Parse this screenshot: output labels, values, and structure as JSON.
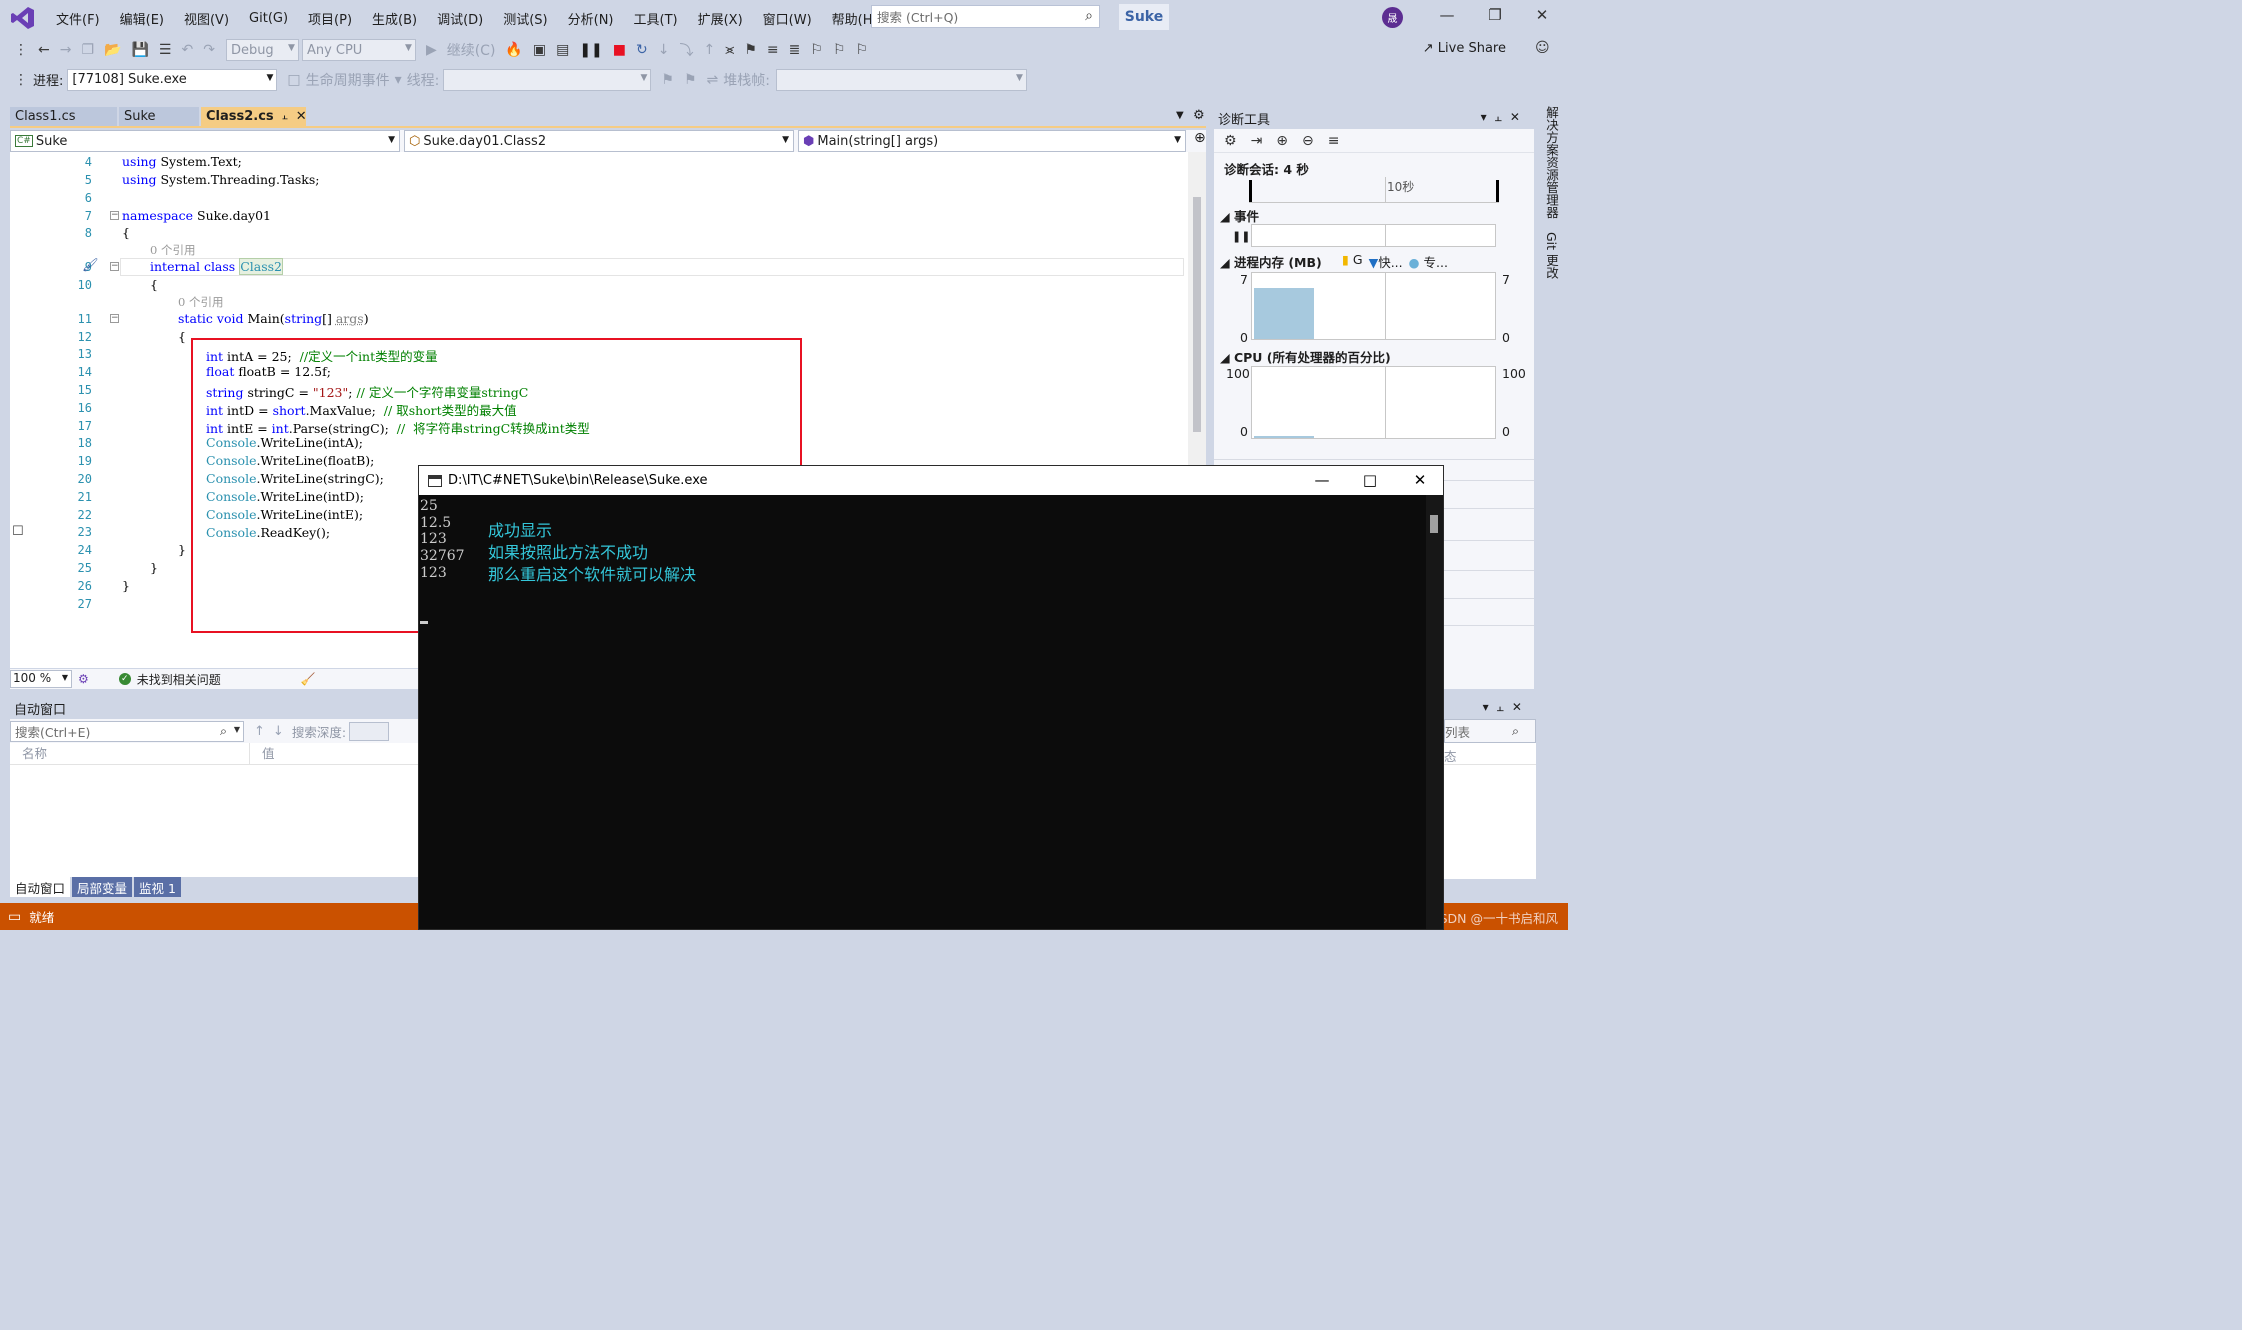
{
  "menu": {
    "items": [
      "文件(F)",
      "编辑(E)",
      "视图(V)",
      "Git(G)",
      "项目(P)",
      "生成(B)",
      "调试(D)",
      "测试(S)",
      "分析(N)",
      "工具(T)",
      "扩展(X)",
      "窗口(W)",
      "帮助(H)"
    ],
    "search_placeholder": "搜索 (Ctrl+Q)",
    "solution_name": "Suke",
    "avatar_initial": "晟"
  },
  "toolbar": {
    "config": "Debug",
    "platform": "Any CPU",
    "continue_label": "继续(C)",
    "live_share": "Live Share",
    "process_label": "进程:",
    "process_value": "[77108] Suke.exe",
    "lifecycle_label": "生命周期事件",
    "thread_label": "线程:",
    "stack_label": "堆栈帧:"
  },
  "tabs": [
    {
      "label": "Class1.cs"
    },
    {
      "label": "Suke"
    },
    {
      "label": "Class2.cs"
    }
  ],
  "navbar": {
    "project": "Suke",
    "type": "Suke.day01.Class2",
    "member": "Main(string[] args)"
  },
  "editor": {
    "line_numbers": [
      "4",
      "5",
      "6",
      "7",
      "8",
      "9",
      "10",
      "11",
      "12",
      "13",
      "14",
      "15",
      "16",
      "17",
      "18",
      "19",
      "20",
      "21",
      "22",
      "23",
      "24",
      "25",
      "26",
      "27"
    ],
    "ref_count": "0 个引用",
    "lines": {
      "l4a": "using",
      "l4b": " System.Text;",
      "l5a": "using",
      "l5b": " System.Threading.Tasks;",
      "l7a": "namespace",
      "l7b": " Suke.day01",
      "l8": "{",
      "l9a": "internal",
      "l9b": " ",
      "l9c": "class",
      "l9d": " ",
      "l9e": "Class2",
      "l10": "{",
      "l11a": "static",
      "l11b": " ",
      "l11c": "void",
      "l11d": " Main(",
      "l11e": "string",
      "l11f": "[] ",
      "l11g": "args",
      "l11h": ")",
      "l12": "{",
      "l13a": "int",
      "l13b": " intA = 25;  ",
      "l13c": "//定义一个int类型的变量",
      "l14a": "float",
      "l14b": " floatB = 12.5f;",
      "l15a": "string",
      "l15b": " stringC = ",
      "l15c": "\"123\"",
      "l15d": "; ",
      "l15e": "// 定义一个字符串变量stringC",
      "l16a": "int",
      "l16b": " intD = ",
      "l16c": "short",
      "l16d": ".MaxValue;  ",
      "l16e": "// 取short类型的最大值",
      "l17a": "int",
      "l17b": " intE = ",
      "l17c": "int",
      "l17d": ".Parse(stringC);  ",
      "l17e": "//  将字符串stringC转换成int类型",
      "l18a": "Console",
      "l18b": ".WriteLine(intA);",
      "l19a": "Console",
      "l19b": ".WriteLine(floatB);",
      "l20a": "Console",
      "l20b": ".WriteLine(stringC);",
      "l21a": "Console",
      "l21b": ".WriteLine(intD);",
      "l22a": "Console",
      "l22b": ".WriteLine(intE);",
      "l23a": "Console",
      "l23b": ".ReadKey();",
      "l24": "}",
      "l25": "}",
      "l26": "}"
    },
    "zoom": "100 %",
    "issues": "未找到相关问题"
  },
  "diagnostics": {
    "title": "诊断工具",
    "session": "诊断会话: 4 秒",
    "timeline_tick": "10秒",
    "events": "事件",
    "memory": "进程内存 (MB)",
    "legend": [
      "G",
      "快...",
      "专..."
    ],
    "mem_max": "7",
    "mem_min": "0",
    "cpu": "CPU (所有处理器的百分比)",
    "cpu_max": "100",
    "cpu_min": "0",
    "memory_fill": 0.8,
    "colors": {
      "memory_fill": "#a7c9de"
    }
  },
  "side_tabs": [
    "解决方案资源管理器",
    "Git 更改"
  ],
  "autos": {
    "title": "自动窗口",
    "search_placeholder": "搜索(Ctrl+E)",
    "search_depth": "搜索深度:",
    "col_name": "名称",
    "col_value": "值",
    "tabs": [
      "自动窗口",
      "局部变量",
      "监视 1"
    ]
  },
  "right_lower": {
    "list_label": "列表",
    "col_state": "态"
  },
  "statusbar": {
    "ready": "就绪",
    "watermark": "CSDN @一十书启和风"
  },
  "console": {
    "title": "D:\\IT\\C#NET\\Suke\\bin\\Release\\Suke.exe",
    "output": [
      "25",
      "12.5",
      "123",
      "32767",
      "123"
    ],
    "notes": [
      "成功显示",
      "如果按照此方法不成功",
      "那么重启这个软件就可以解决"
    ]
  },
  "colors": {
    "status_bar": "#ca5100",
    "highlight_box": "#e81123",
    "active_tab": "#f5cc84",
    "console_note": "#34c6d9"
  }
}
